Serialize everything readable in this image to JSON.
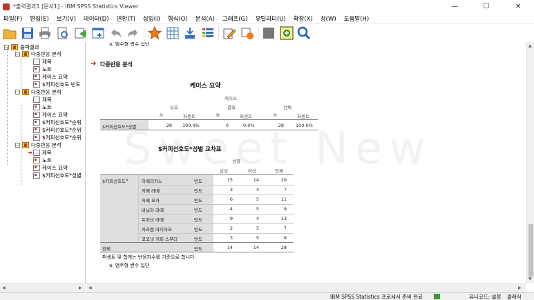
{
  "window": {
    "title": "*출력결과1 [문서1] - IBM SPSS Statistics Viewer"
  },
  "window_controls": {
    "minimize": "—",
    "maximize": "☐",
    "close": "✕"
  },
  "menu": [
    "파일(F)",
    "편집(E)",
    "보기(V)",
    "데이터(D)",
    "변환(T)",
    "삽입(I)",
    "형식(O)",
    "분석(A)",
    "그래프(G)",
    "유틸리티(U)",
    "확장(X)",
    "창(W)",
    "도움말(H)"
  ],
  "outline": {
    "root": "출력결과",
    "groups": [
      {
        "label": "다중반응 분석",
        "items": [
          "제목",
          "노트",
          "케이스 요약",
          "$커피선호도 빈도"
        ]
      },
      {
        "label": "다중반응 분석",
        "items": [
          "제목",
          "노트",
          "케이스 요약",
          "$커피선호도*순위",
          "$커피선호도*순위",
          "$커피선호도*순위"
        ]
      },
      {
        "label": "다중반응 분석",
        "items": [
          "제목",
          "노트",
          "케이스 요약",
          "$커피선호도*성별"
        ]
      }
    ]
  },
  "output": {
    "top_footnote": "a. 범주형 변수 집단",
    "section_title": "다중반응 분석",
    "watermark": "Sweet New",
    "case_summary": {
      "title": "케이스 요약",
      "super_header": "케이스",
      "groups": [
        "유효",
        "결측",
        "전체"
      ],
      "sub_headers": [
        "N",
        "퍼센트",
        "N",
        "퍼센트",
        "N",
        "퍼센트"
      ],
      "row_label": "$커피선호도*성별",
      "row_values": [
        "28",
        "100.0%",
        "0",
        "0.0%",
        "28",
        "100.0%"
      ]
    },
    "crosstab": {
      "title": "$커피선호도*성별 교차표",
      "col_super": "성별",
      "col_headers": [
        "남성",
        "여성",
        "전체"
      ],
      "row_var": "$커피선호도",
      "row_var_sup": "a",
      "stat_label": "빈도",
      "rows": [
        {
          "label": "아메리카노",
          "values": [
            "15",
            "14",
            "29"
          ]
        },
        {
          "label": "카페 라떼",
          "values": [
            "3",
            "4",
            "7"
          ]
        },
        {
          "label": "카페 모카",
          "values": [
            "6",
            "5",
            "11"
          ]
        },
        {
          "label": "바닐라 라떼",
          "values": [
            "4",
            "5",
            "9"
          ]
        },
        {
          "label": "토피넛 라떼",
          "values": [
            "9",
            "4",
            "13"
          ]
        },
        {
          "label": "카라멜 마끼아또",
          "values": [
            "2",
            "5",
            "7"
          ]
        },
        {
          "label": "코코넛 커피 스무디",
          "values": [
            "3",
            "5",
            "8"
          ]
        }
      ],
      "total_label": "전체",
      "total_values": [
        "14",
        "14",
        "28"
      ],
      "footnote1": "퍼센트 및 합계는 반응자수를 기준으로 합니다.",
      "footnote2": "a. 범주형 변수 집단"
    }
  },
  "status": {
    "processor": "IBM SPSS Statistics 프로세서 준비 완료",
    "unicode": "유니코드: 설정",
    "mode": "클래식"
  },
  "colors": {
    "accent_red": "#d10000",
    "table_gray": "#dedede"
  }
}
